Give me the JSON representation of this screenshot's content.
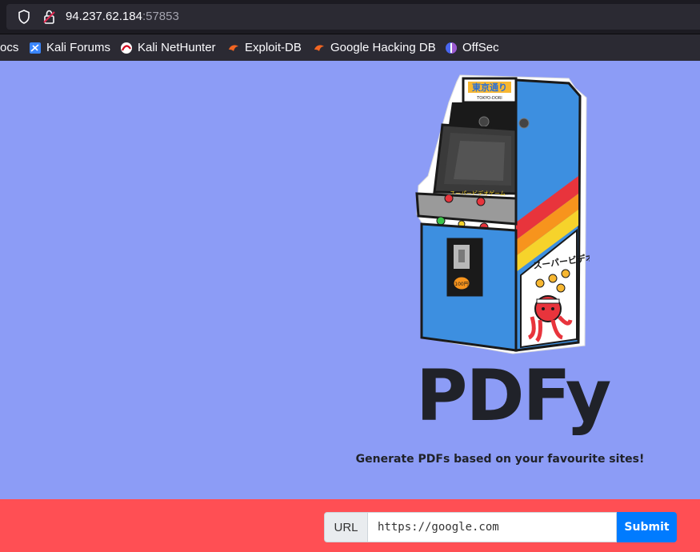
{
  "browser": {
    "url_host": "94.237.62.184",
    "url_port": ":57853",
    "bookmarks": [
      {
        "label": "ocs",
        "icon": "none"
      },
      {
        "label": "Kali Forums",
        "icon": "kali-forums-icon"
      },
      {
        "label": "Kali NetHunter",
        "icon": "kali-nethunter-icon"
      },
      {
        "label": "Exploit-DB",
        "icon": "exploit-db-icon"
      },
      {
        "label": "Google Hacking DB",
        "icon": "exploit-db-icon"
      },
      {
        "label": "OffSec",
        "icon": "offsec-icon"
      }
    ]
  },
  "page": {
    "title": "PDFy",
    "tagline": "Generate PDFs based on your favourite sites!",
    "arcade_marquee": "東京通り",
    "arcade_sub": "TOKYO-DORI",
    "arcade_side_text": "スーパービデオゲーム",
    "arcade_screen_text": "スーパービデオゲーム",
    "coin_label": "100円",
    "background_color": "#8c9cf6",
    "footer_color": "#ff4f54"
  },
  "form": {
    "label": "URL",
    "input_value": "https://google.com",
    "submit_label": "Submit"
  }
}
